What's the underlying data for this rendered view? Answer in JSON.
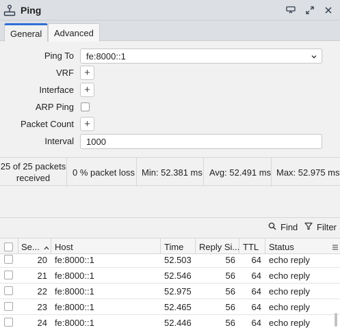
{
  "window": {
    "title": "Ping",
    "app_icon": "joystick-icon",
    "buttons": [
      "restore-window-icon",
      "maximize-icon",
      "close-icon"
    ]
  },
  "tabs": [
    {
      "label": "General",
      "active": true
    },
    {
      "label": "Advanced",
      "active": false
    }
  ],
  "form": {
    "ping_to": {
      "label": "Ping To",
      "value": "fe:8000::1"
    },
    "vrf": {
      "label": "VRF"
    },
    "interface": {
      "label": "Interface"
    },
    "arp_ping": {
      "label": "ARP Ping",
      "checked": false
    },
    "packet_count": {
      "label": "Packet Count"
    },
    "interval": {
      "label": "Interval",
      "value": "1000"
    }
  },
  "stats": {
    "received": "25 of 25 packets received",
    "loss": "0 % packet loss",
    "min": "Min: 52.381 ms",
    "avg": "Avg: 52.491 ms",
    "max": "Max: 52.975 ms"
  },
  "toolbar": {
    "find_label": "Find",
    "filter_label": "Filter"
  },
  "table": {
    "columns": [
      "Se...",
      "Host",
      "Time",
      "Reply Si...",
      "TTL",
      "Status"
    ],
    "rows": [
      {
        "seq": "20",
        "host": "fe:8000::1",
        "time": "52.503",
        "reply_size": "56",
        "ttl": "64",
        "status": "echo reply"
      },
      {
        "seq": "21",
        "host": "fe:8000::1",
        "time": "52.546",
        "reply_size": "56",
        "ttl": "64",
        "status": "echo reply"
      },
      {
        "seq": "22",
        "host": "fe:8000::1",
        "time": "52.975",
        "reply_size": "56",
        "ttl": "64",
        "status": "echo reply"
      },
      {
        "seq": "23",
        "host": "fe:8000::1",
        "time": "52.465",
        "reply_size": "56",
        "ttl": "64",
        "status": "echo reply"
      },
      {
        "seq": "24",
        "host": "fe:8000::1",
        "time": "52.446",
        "reply_size": "56",
        "ttl": "64",
        "status": "echo reply"
      }
    ]
  }
}
